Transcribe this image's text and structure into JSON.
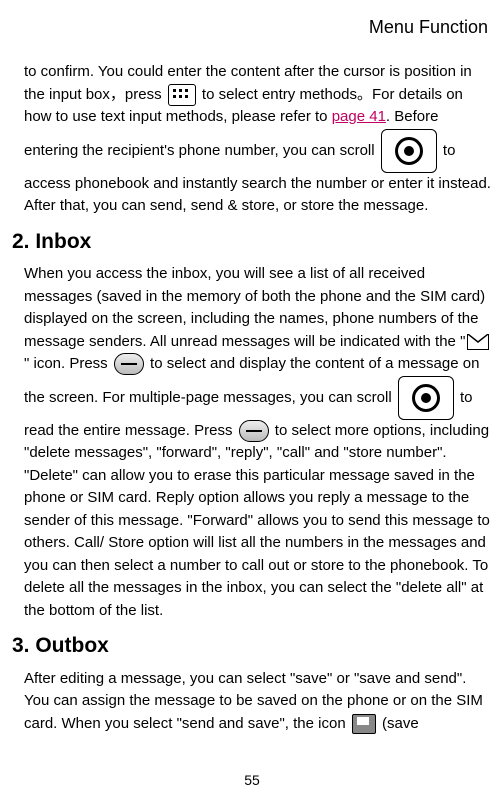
{
  "header": "Menu Function",
  "intro": {
    "p1a": "to confirm. You could enter the content after the cursor is position in the input box，press ",
    "p1b": " to select entry methods。For details on how to use text input methods, please refer to ",
    "pagelink": "page 41",
    "p1c": ". Before entering the recipient's phone number, you can scroll ",
    "p1d": " to access phonebook and instantly search the number or enter it instead. After that, you can send, send & store, or store the message."
  },
  "inbox": {
    "title": "2. Inbox",
    "a": "When you access the inbox, you will see a list of all received messages (saved in the memory of both the phone and the SIM card) displayed on the screen, including the names, phone numbers of the message senders. All unread messages will be indicated with the \"",
    "b": "\" icon. Press ",
    "c": " to select and display the content of a message on the screen. For multiple-page messages, you can scroll ",
    "d": " to read the entire message. Press ",
    "e": " to select more options, including \"delete messages\", \"forward\", \"reply\", \"call\" and \"store number\". \"Delete\" can allow you to erase this particular message saved in the phone or SIM card. Reply option allows you reply a message to the sender of this message. \"Forward\" allows you to send this message to others. Call/ Store option will list all the numbers in the messages and you can then select a number to call out or store to the phonebook. To delete all the messages in the inbox, you can select the \"delete all\" at the bottom of the list."
  },
  "outbox": {
    "title": "3. Outbox",
    "a": "After editing a message, you can select \"save\" or \"save and send\". You can assign the message to be saved on the phone or on the SIM card. When you select \"send and save\", the icon ",
    "b": " (save"
  },
  "pageNumber": "55"
}
